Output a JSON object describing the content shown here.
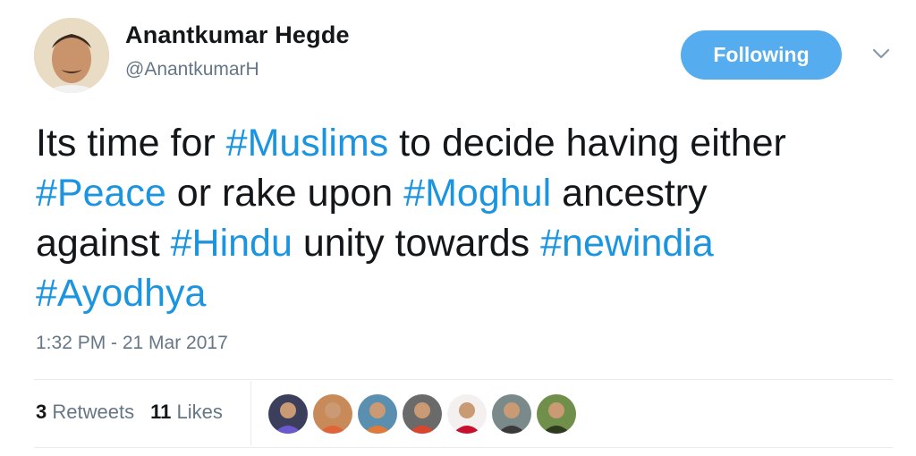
{
  "user": {
    "display_name": "Anantkumar Hegde",
    "handle": "@AnantkumarH"
  },
  "follow_button_label": "Following",
  "tweet": {
    "lines": [
      [
        {
          "text": "Its time for ",
          "hashtag": false
        },
        {
          "text": "#Muslims",
          "hashtag": true
        },
        {
          "text": " to decide having either",
          "hashtag": false
        }
      ],
      [
        {
          "text": "#Peace",
          "hashtag": true
        },
        {
          "text": " or rake upon ",
          "hashtag": false
        },
        {
          "text": "#Moghul",
          "hashtag": true
        },
        {
          "text": " ancestry",
          "hashtag": false
        }
      ],
      [
        {
          "text": "against ",
          "hashtag": false
        },
        {
          "text": "#Hindu",
          "hashtag": true
        },
        {
          "text": " unity towards ",
          "hashtag": false
        },
        {
          "text": "#newindia",
          "hashtag": true
        }
      ],
      [
        {
          "text": "#Ayodhya",
          "hashtag": true
        }
      ]
    ],
    "timestamp": "1:32 PM - 21 Mar 2017"
  },
  "stats": {
    "retweets_count": "3",
    "retweets_label": "Retweets",
    "likes_count": "11",
    "likes_label": "Likes"
  },
  "likers": [
    {
      "bg": "#3b3f5c",
      "fg": "#6a5acd"
    },
    {
      "bg": "#c98a5a",
      "fg": "#e0643a"
    },
    {
      "bg": "#5b8fb0",
      "fg": "#e07a3a"
    },
    {
      "bg": "#6a6a6a",
      "fg": "#d9452f"
    },
    {
      "bg": "#f5f0f0",
      "fg": "#c8102e"
    },
    {
      "bg": "#7a8a8a",
      "fg": "#3a3a3a"
    },
    {
      "bg": "#6f8f4a",
      "fg": "#2e3a1e"
    }
  ],
  "colors": {
    "accent": "#55acee",
    "hashtag": "#1b95e0",
    "secondary_text": "#657786"
  },
  "icons": {
    "dropdown": "chevron-down-icon"
  }
}
